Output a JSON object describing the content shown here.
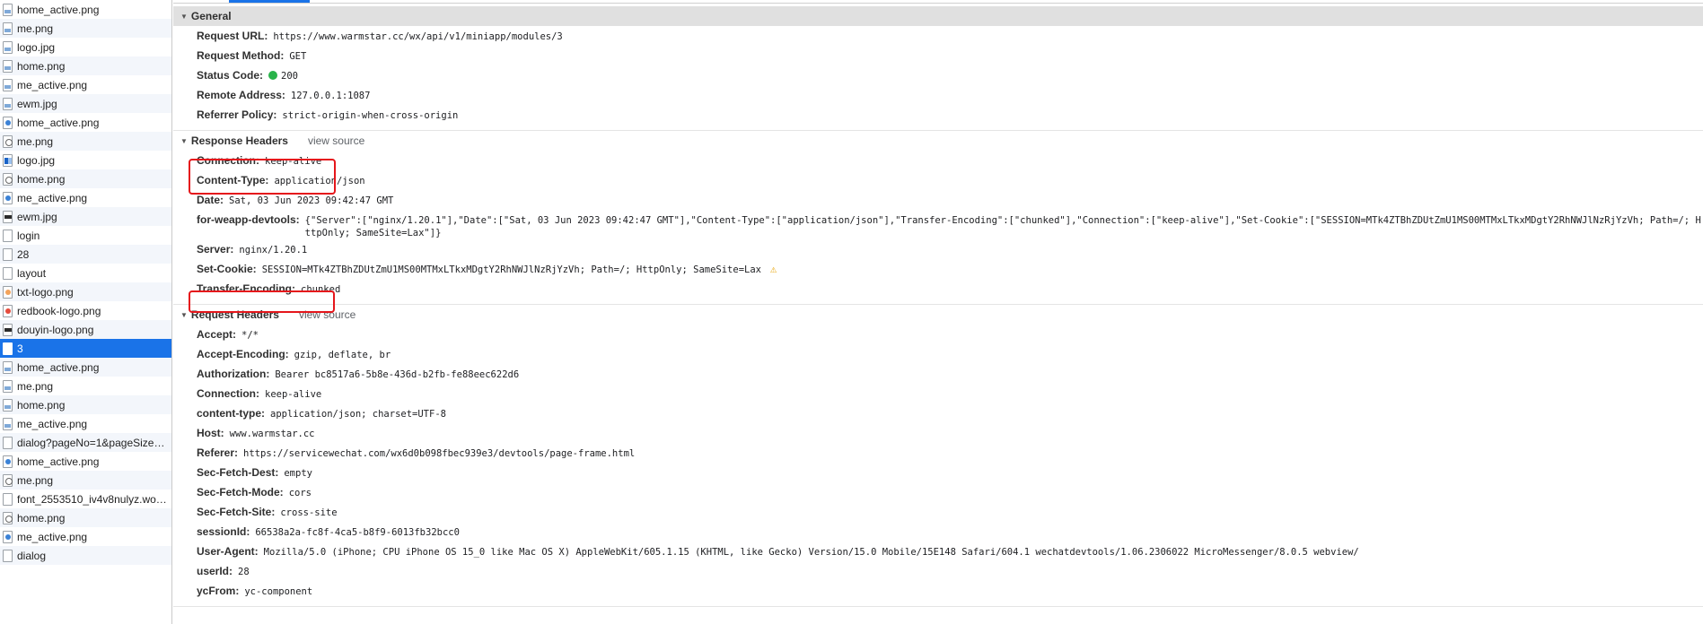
{
  "requests": [
    {
      "name": "home_active.png",
      "icon": "image-file-icon",
      "kind": "img"
    },
    {
      "name": "me.png",
      "icon": "image-file-icon",
      "kind": "img"
    },
    {
      "name": "logo.jpg",
      "icon": "image-file-icon",
      "kind": "img"
    },
    {
      "name": "home.png",
      "icon": "image-file-icon",
      "kind": "img"
    },
    {
      "name": "me_active.png",
      "icon": "image-file-icon",
      "kind": "img"
    },
    {
      "name": "ewm.jpg",
      "icon": "image-file-icon",
      "kind": "img"
    },
    {
      "name": "home_active.png",
      "icon": "image-file-icon",
      "kind": "img-blue"
    },
    {
      "name": "me.png",
      "icon": "image-file-icon",
      "kind": "img-round"
    },
    {
      "name": "logo.jpg",
      "icon": "image-file-icon",
      "kind": "img-tile"
    },
    {
      "name": "home.png",
      "icon": "image-file-icon",
      "kind": "img-round"
    },
    {
      "name": "me_active.png",
      "icon": "image-file-icon",
      "kind": "img-blue"
    },
    {
      "name": "ewm.jpg",
      "icon": "image-file-icon",
      "kind": "img-dark"
    },
    {
      "name": "login",
      "icon": "document-file-icon",
      "kind": "doc"
    },
    {
      "name": "28",
      "icon": "document-file-icon",
      "kind": "doc"
    },
    {
      "name": "layout",
      "icon": "document-file-icon",
      "kind": "doc"
    },
    {
      "name": "txt-logo.png",
      "icon": "image-file-icon",
      "kind": "img-orange"
    },
    {
      "name": "redbook-logo.png",
      "icon": "image-file-icon",
      "kind": "img-red"
    },
    {
      "name": "douyin-logo.png",
      "icon": "image-file-icon",
      "kind": "img-dark"
    },
    {
      "name": "3",
      "icon": "document-file-icon",
      "kind": "doc",
      "selected": true
    },
    {
      "name": "home_active.png",
      "icon": "image-file-icon",
      "kind": "img"
    },
    {
      "name": "me.png",
      "icon": "image-file-icon",
      "kind": "img"
    },
    {
      "name": "home.png",
      "icon": "image-file-icon",
      "kind": "img"
    },
    {
      "name": "me_active.png",
      "icon": "image-file-icon",
      "kind": "img"
    },
    {
      "name": "dialog?pageNo=1&pageSize…",
      "icon": "document-file-icon",
      "kind": "doc"
    },
    {
      "name": "home_active.png",
      "icon": "image-file-icon",
      "kind": "img-blue"
    },
    {
      "name": "me.png",
      "icon": "image-file-icon",
      "kind": "img-round"
    },
    {
      "name": "font_2553510_iv4v8nulyz.wo…",
      "icon": "document-file-icon",
      "kind": "doc"
    },
    {
      "name": "home.png",
      "icon": "image-file-icon",
      "kind": "img-round"
    },
    {
      "name": "me_active.png",
      "icon": "image-file-icon",
      "kind": "img-blue"
    },
    {
      "name": "dialog",
      "icon": "document-file-icon",
      "kind": "doc"
    }
  ],
  "general": {
    "title": "General",
    "rows": [
      {
        "key": "Request URL:",
        "value": "https://www.warmstar.cc/wx/api/v1/miniapp/modules/3"
      },
      {
        "key": "Request Method:",
        "value": "GET"
      },
      {
        "key": "Status Code:",
        "value": "200",
        "status_dot_color": "#29b34a"
      },
      {
        "key": "Remote Address:",
        "value": "127.0.0.1:1087"
      },
      {
        "key": "Referrer Policy:",
        "value": "strict-origin-when-cross-origin"
      }
    ]
  },
  "response_headers": {
    "title": "Response Headers",
    "view_source": "view source",
    "rows": [
      {
        "key": "Connection:",
        "value": "keep-alive"
      },
      {
        "key": "Content-Type:",
        "value": "application/json"
      },
      {
        "key": "Date:",
        "value": "Sat, 03 Jun 2023 09:42:47 GMT"
      },
      {
        "key": "for-weapp-devtools:",
        "value": "{\"Server\":[\"nginx/1.20.1\"],\"Date\":[\"Sat, 03 Jun 2023 09:42:47 GMT\"],\"Content-Type\":[\"application/json\"],\"Transfer-Encoding\":[\"chunked\"],\"Connection\":[\"keep-alive\"],\"Set-Cookie\":[\"SESSION=MTk4ZTBhZDUtZmU1MS00MTMxLTkxMDgtY2RhNWJlNzRjYzVh; Path=/; HttpOnly; SameSite=Lax\"]}",
        "wrap": true
      },
      {
        "key": "Server:",
        "value": "nginx/1.20.1"
      },
      {
        "key": "Set-Cookie:",
        "value": "SESSION=MTk4ZTBhZDUtZmU1MS00MTMxLTkxMDgtY2RhNWJlNzRjYzVh; Path=/; HttpOnly; SameSite=Lax",
        "warning": "⚠"
      },
      {
        "key": "Transfer-Encoding:",
        "value": "chunked"
      }
    ]
  },
  "request_headers": {
    "title": "Request Headers",
    "view_source": "view source",
    "rows": [
      {
        "key": "Accept:",
        "value": "*/*"
      },
      {
        "key": "Accept-Encoding:",
        "value": "gzip, deflate, br"
      },
      {
        "key": "Authorization:",
        "value": "Bearer bc8517a6-5b8e-436d-b2fb-fe88eec622d6"
      },
      {
        "key": "Connection:",
        "value": "keep-alive"
      },
      {
        "key": "content-type:",
        "value": "application/json; charset=UTF-8"
      },
      {
        "key": "Host:",
        "value": "www.warmstar.cc"
      },
      {
        "key": "Referer:",
        "value": "https://servicewechat.com/wx6d0b098fbec939e3/devtools/page-frame.html"
      },
      {
        "key": "Sec-Fetch-Dest:",
        "value": "empty"
      },
      {
        "key": "Sec-Fetch-Mode:",
        "value": "cors"
      },
      {
        "key": "Sec-Fetch-Site:",
        "value": "cross-site"
      },
      {
        "key": "sessionId:",
        "value": "66538a2a-fc8f-4ca5-b8f9-6013fb32bcc0"
      },
      {
        "key": "User-Agent:",
        "value": "Mozilla/5.0 (iPhone; CPU iPhone OS 15_0 like Mac OS X) AppleWebKit/605.1.15 (KHTML, like Gecko) Version/15.0 Mobile/15E148 Safari/604.1 wechatdevtools/1.06.2306022 MicroMessenger/8.0.5 webview/"
      },
      {
        "key": "userId:",
        "value": "28"
      },
      {
        "key": "ycFrom:",
        "value": "yc-component"
      }
    ]
  },
  "colors": {
    "selection": "#1a73e8",
    "highlight_box": "#e5161b",
    "status_ok": "#29b34a",
    "warning": "#e8a302"
  }
}
